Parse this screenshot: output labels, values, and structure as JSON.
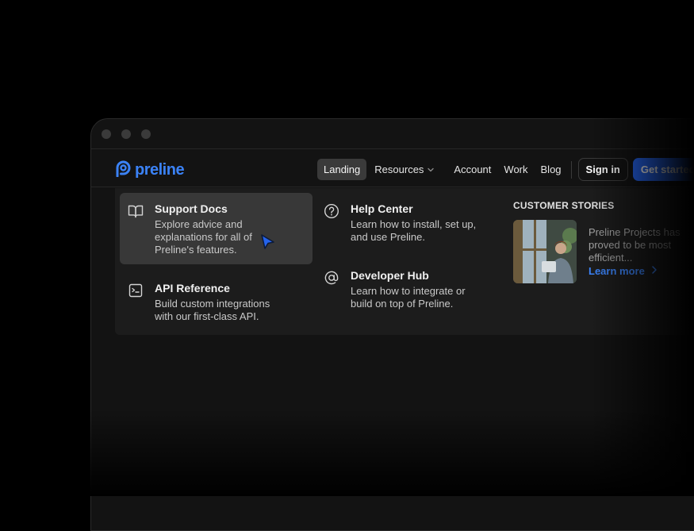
{
  "brand": {
    "name": "preline",
    "color": "#3b82f6"
  },
  "nav": {
    "items": [
      "Landing",
      "Resources",
      "Account",
      "Work",
      "Blog"
    ],
    "active": "Landing",
    "signin_label": "Sign in",
    "cta_label": "Get started"
  },
  "menu": {
    "columns": [
      {
        "items": [
          {
            "icon": "book-icon",
            "title": "Support Docs",
            "desc": "Explore advice and explanations for all of Preline's features."
          },
          {
            "icon": "terminal-icon",
            "title": "API Reference",
            "desc": "Build custom integrations with our first-class API."
          }
        ]
      },
      {
        "items": [
          {
            "icon": "help-circle-icon",
            "title": "Help Center",
            "desc": "Learn how to install, set up, and use Preline."
          },
          {
            "icon": "at-sign-icon",
            "title": "Developer Hub",
            "desc": "Learn how to integrate or build on top of Preline."
          }
        ]
      }
    ]
  },
  "stories": {
    "heading": "CUSTOMER STORIES",
    "text": "Preline Projects has proved to be most efficient...",
    "link_label": "Learn more"
  },
  "colors": {
    "background": "#000000",
    "window": "#131313",
    "menu_panel": "#1c1c1c",
    "accent": "#3b82f6",
    "cta": "#2563eb"
  }
}
